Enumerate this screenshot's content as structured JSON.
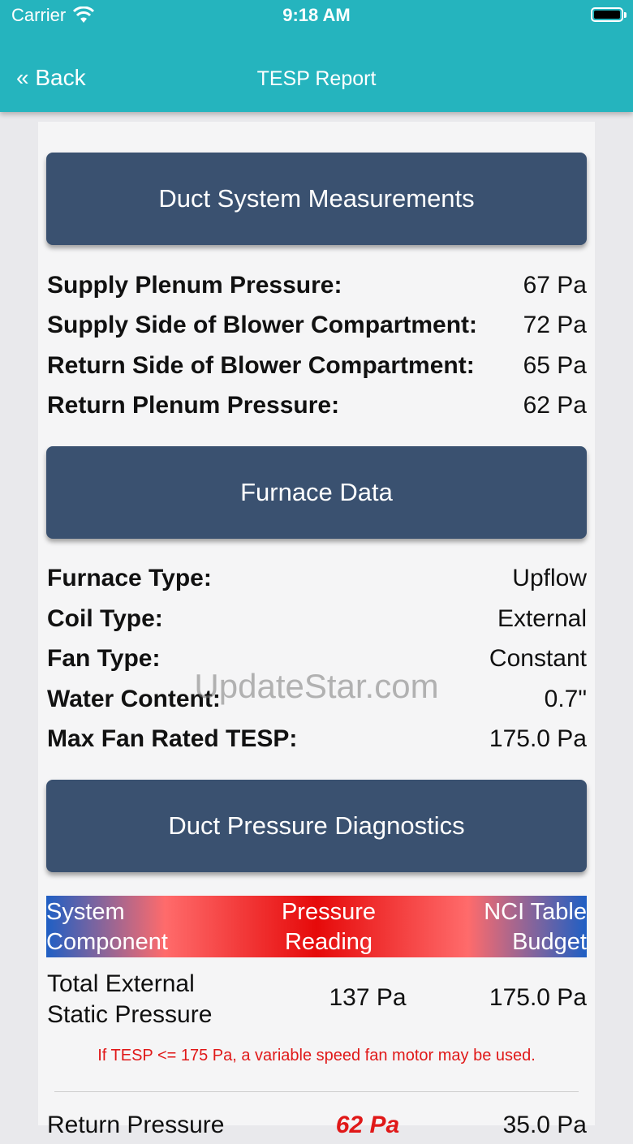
{
  "status": {
    "carrier": "Carrier",
    "time": "9:18 AM"
  },
  "nav": {
    "back": "« Back",
    "title": "TESP Report"
  },
  "sections": {
    "duct": "Duct System Measurements",
    "furnace": "Furnace Data",
    "diagnostics": "Duct Pressure Diagnostics"
  },
  "duct_rows": [
    {
      "label": "Supply Plenum Pressure:",
      "value": "67 Pa"
    },
    {
      "label": "Supply Side of Blower Compartment:",
      "value": "72 Pa"
    },
    {
      "label": "Return Side of Blower Compartment:",
      "value": "65 Pa"
    },
    {
      "label": "Return Plenum Pressure:",
      "value": "62 Pa"
    }
  ],
  "furnace_rows": [
    {
      "label": "Furnace Type:",
      "value": "Upflow"
    },
    {
      "label": "Coil Type:",
      "value": "External"
    },
    {
      "label": "Fan Type:",
      "value": "Constant"
    },
    {
      "label": "Water Content:",
      "value": "0.7\""
    },
    {
      "label": "Max Fan Rated TESP:",
      "value": "175.0 Pa"
    }
  ],
  "watermark": "UpdateStar.com",
  "table": {
    "headers": {
      "col1_line1": "System",
      "col1_line2": "Component",
      "col2_line1": "Pressure",
      "col2_line2": "Reading",
      "col3_line1": "NCI Table",
      "col3_line2": "Budget"
    },
    "row1": {
      "name_line1": "Total External",
      "name_line2": "Static Pressure",
      "reading": "137 Pa",
      "budget": "175.0 Pa"
    },
    "note": "If TESP <= 175 Pa, a variable speed fan motor may be used.",
    "row2": {
      "name_line1": "Return Pressure",
      "reading": "62 Pa",
      "budget": "35.0 Pa"
    }
  }
}
